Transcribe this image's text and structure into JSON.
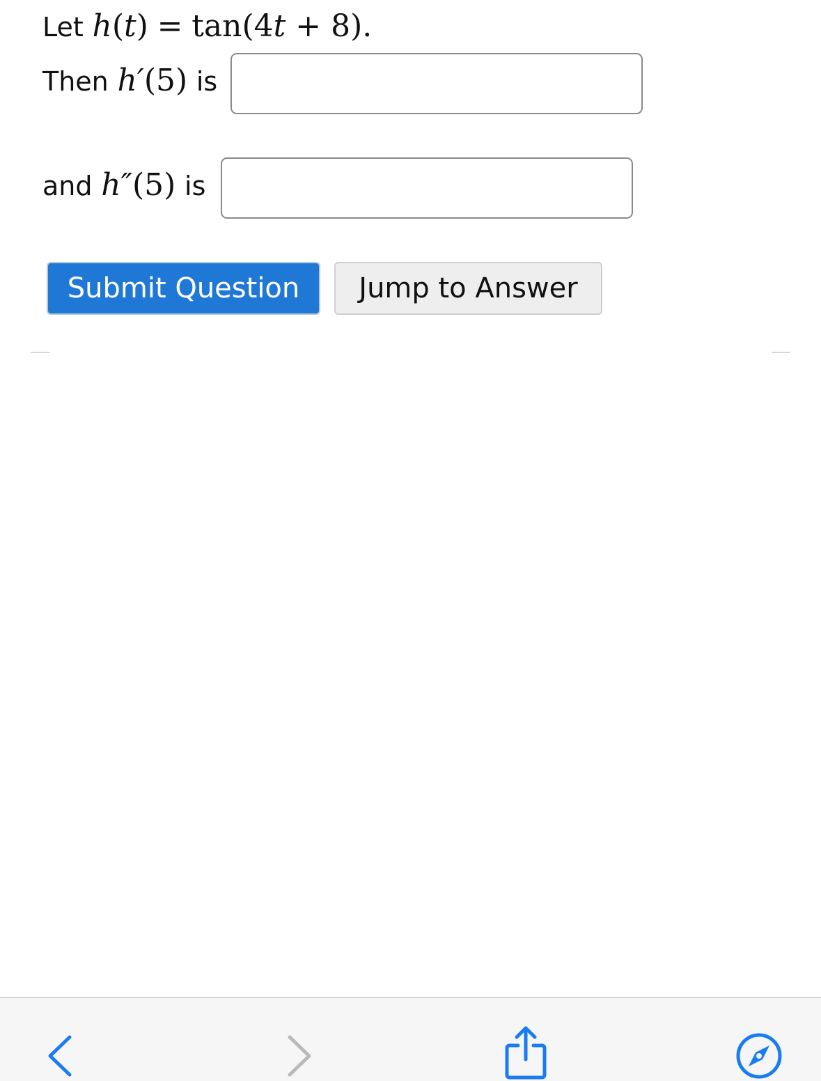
{
  "question": {
    "line1": {
      "prefix": "Let",
      "fn": "h",
      "arg": "(t)",
      "eq": "=",
      "expr": "tan(4",
      "var": "t",
      "plus": "+ 8).",
      "note": ""
    },
    "line2": {
      "prefix": "Then",
      "fn": "h",
      "prime": "′",
      "arg": "(5)",
      "suffix": "is"
    },
    "line3": {
      "prefix": "and",
      "fn": "h",
      "prime": "″",
      "arg": "(5)",
      "suffix": "is"
    },
    "answer1": {
      "value": "",
      "placeholder": ""
    },
    "answer2": {
      "value": "",
      "placeholder": ""
    }
  },
  "buttons": {
    "submit_label": "Submit Question",
    "jump_label": "Jump to Answer"
  },
  "colors": {
    "primary": "#1f78d5",
    "ios_blue": "#1a7cf2"
  },
  "toolbar": {
    "icons": [
      "back-icon",
      "forward-icon",
      "share-icon",
      "compass-icon"
    ]
  }
}
